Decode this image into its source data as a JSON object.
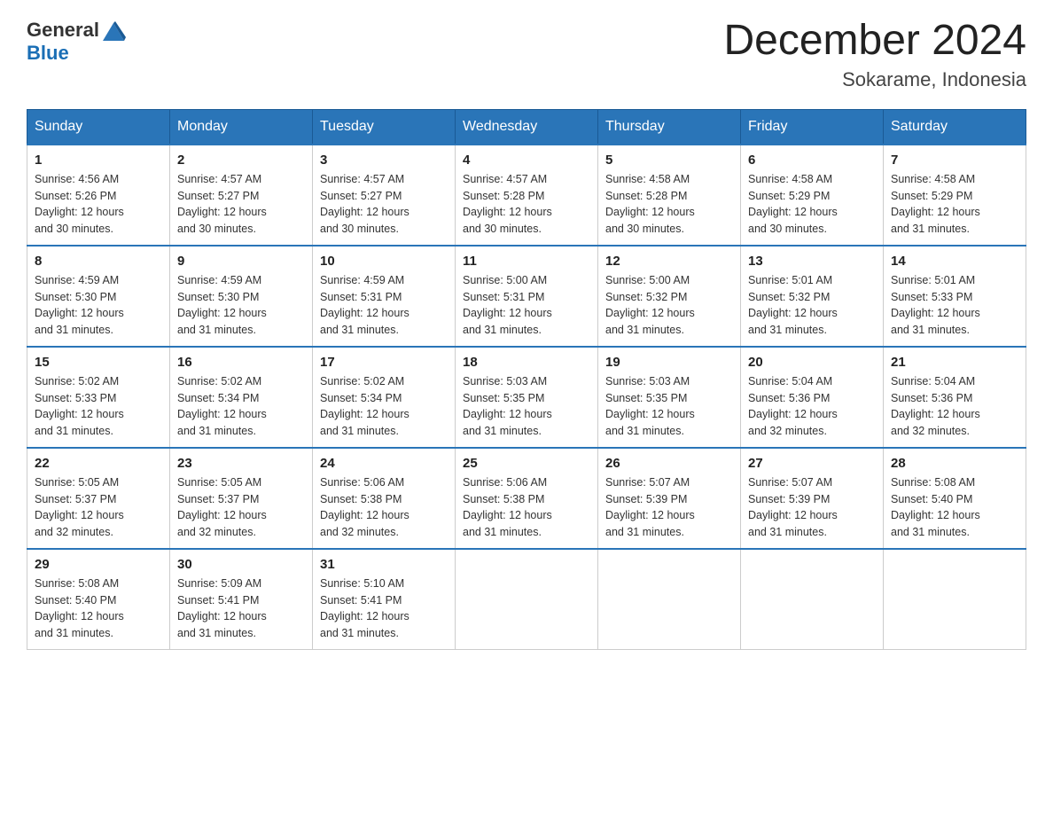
{
  "header": {
    "logo_general": "General",
    "logo_blue": "Blue",
    "title": "December 2024",
    "subtitle": "Sokarame, Indonesia"
  },
  "days_of_week": [
    "Sunday",
    "Monday",
    "Tuesday",
    "Wednesday",
    "Thursday",
    "Friday",
    "Saturday"
  ],
  "weeks": [
    {
      "days": [
        {
          "num": "1",
          "sunrise": "4:56 AM",
          "sunset": "5:26 PM",
          "daylight": "12 hours and 30 minutes."
        },
        {
          "num": "2",
          "sunrise": "4:57 AM",
          "sunset": "5:27 PM",
          "daylight": "12 hours and 30 minutes."
        },
        {
          "num": "3",
          "sunrise": "4:57 AM",
          "sunset": "5:27 PM",
          "daylight": "12 hours and 30 minutes."
        },
        {
          "num": "4",
          "sunrise": "4:57 AM",
          "sunset": "5:28 PM",
          "daylight": "12 hours and 30 minutes."
        },
        {
          "num": "5",
          "sunrise": "4:58 AM",
          "sunset": "5:28 PM",
          "daylight": "12 hours and 30 minutes."
        },
        {
          "num": "6",
          "sunrise": "4:58 AM",
          "sunset": "5:29 PM",
          "daylight": "12 hours and 30 minutes."
        },
        {
          "num": "7",
          "sunrise": "4:58 AM",
          "sunset": "5:29 PM",
          "daylight": "12 hours and 31 minutes."
        }
      ]
    },
    {
      "days": [
        {
          "num": "8",
          "sunrise": "4:59 AM",
          "sunset": "5:30 PM",
          "daylight": "12 hours and 31 minutes."
        },
        {
          "num": "9",
          "sunrise": "4:59 AM",
          "sunset": "5:30 PM",
          "daylight": "12 hours and 31 minutes."
        },
        {
          "num": "10",
          "sunrise": "4:59 AM",
          "sunset": "5:31 PM",
          "daylight": "12 hours and 31 minutes."
        },
        {
          "num": "11",
          "sunrise": "5:00 AM",
          "sunset": "5:31 PM",
          "daylight": "12 hours and 31 minutes."
        },
        {
          "num": "12",
          "sunrise": "5:00 AM",
          "sunset": "5:32 PM",
          "daylight": "12 hours and 31 minutes."
        },
        {
          "num": "13",
          "sunrise": "5:01 AM",
          "sunset": "5:32 PM",
          "daylight": "12 hours and 31 minutes."
        },
        {
          "num": "14",
          "sunrise": "5:01 AM",
          "sunset": "5:33 PM",
          "daylight": "12 hours and 31 minutes."
        }
      ]
    },
    {
      "days": [
        {
          "num": "15",
          "sunrise": "5:02 AM",
          "sunset": "5:33 PM",
          "daylight": "12 hours and 31 minutes."
        },
        {
          "num": "16",
          "sunrise": "5:02 AM",
          "sunset": "5:34 PM",
          "daylight": "12 hours and 31 minutes."
        },
        {
          "num": "17",
          "sunrise": "5:02 AM",
          "sunset": "5:34 PM",
          "daylight": "12 hours and 31 minutes."
        },
        {
          "num": "18",
          "sunrise": "5:03 AM",
          "sunset": "5:35 PM",
          "daylight": "12 hours and 31 minutes."
        },
        {
          "num": "19",
          "sunrise": "5:03 AM",
          "sunset": "5:35 PM",
          "daylight": "12 hours and 31 minutes."
        },
        {
          "num": "20",
          "sunrise": "5:04 AM",
          "sunset": "5:36 PM",
          "daylight": "12 hours and 32 minutes."
        },
        {
          "num": "21",
          "sunrise": "5:04 AM",
          "sunset": "5:36 PM",
          "daylight": "12 hours and 32 minutes."
        }
      ]
    },
    {
      "days": [
        {
          "num": "22",
          "sunrise": "5:05 AM",
          "sunset": "5:37 PM",
          "daylight": "12 hours and 32 minutes."
        },
        {
          "num": "23",
          "sunrise": "5:05 AM",
          "sunset": "5:37 PM",
          "daylight": "12 hours and 32 minutes."
        },
        {
          "num": "24",
          "sunrise": "5:06 AM",
          "sunset": "5:38 PM",
          "daylight": "12 hours and 32 minutes."
        },
        {
          "num": "25",
          "sunrise": "5:06 AM",
          "sunset": "5:38 PM",
          "daylight": "12 hours and 31 minutes."
        },
        {
          "num": "26",
          "sunrise": "5:07 AM",
          "sunset": "5:39 PM",
          "daylight": "12 hours and 31 minutes."
        },
        {
          "num": "27",
          "sunrise": "5:07 AM",
          "sunset": "5:39 PM",
          "daylight": "12 hours and 31 minutes."
        },
        {
          "num": "28",
          "sunrise": "5:08 AM",
          "sunset": "5:40 PM",
          "daylight": "12 hours and 31 minutes."
        }
      ]
    },
    {
      "days": [
        {
          "num": "29",
          "sunrise": "5:08 AM",
          "sunset": "5:40 PM",
          "daylight": "12 hours and 31 minutes."
        },
        {
          "num": "30",
          "sunrise": "5:09 AM",
          "sunset": "5:41 PM",
          "daylight": "12 hours and 31 minutes."
        },
        {
          "num": "31",
          "sunrise": "5:10 AM",
          "sunset": "5:41 PM",
          "daylight": "12 hours and 31 minutes."
        },
        null,
        null,
        null,
        null
      ]
    }
  ],
  "labels": {
    "sunrise": "Sunrise:",
    "sunset": "Sunset:",
    "daylight": "Daylight:"
  }
}
